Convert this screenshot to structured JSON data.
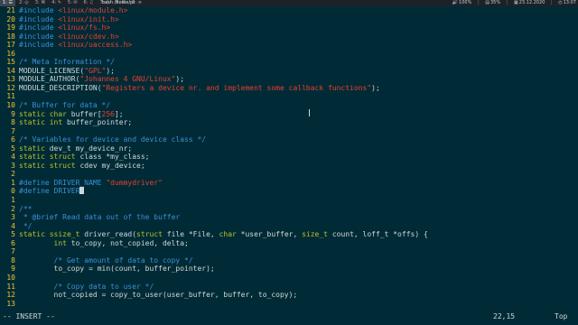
{
  "topbar": {
    "workspaces": [
      "1: ☰",
      "2: ◎",
      "3: ⌘",
      "4: ✎",
      "5: ✉",
      "6: ♫",
      "7: ⬡",
      "8: ☷",
      "9: ≡"
    ],
    "active_workspace": 0,
    "window_title": "bash /home/pi",
    "volume": "100%",
    "cpu": "35%",
    "date": "23.12.2020",
    "time": "13:07"
  },
  "editor": {
    "lines": [
      {
        "n": "21",
        "toks": [
          [
            "pre",
            "#include "
          ],
          [
            "str",
            "<linux/module.h>"
          ]
        ]
      },
      {
        "n": "20",
        "toks": [
          [
            "pre",
            "#include "
          ],
          [
            "str",
            "<linux/init.h>"
          ]
        ]
      },
      {
        "n": "19",
        "toks": [
          [
            "pre",
            "#include "
          ],
          [
            "str",
            "<linux/fs.h>"
          ]
        ]
      },
      {
        "n": "18",
        "toks": [
          [
            "pre",
            "#include "
          ],
          [
            "str",
            "<linux/cdev.h>"
          ]
        ]
      },
      {
        "n": "17",
        "toks": [
          [
            "pre",
            "#include "
          ],
          [
            "str",
            "<linux/uaccess.h>"
          ]
        ]
      },
      {
        "n": "16",
        "toks": []
      },
      {
        "n": "15",
        "toks": [
          [
            "com",
            "/* Meta Information */"
          ]
        ]
      },
      {
        "n": "14",
        "toks": [
          [
            "plain",
            "MODULE_LICENSE("
          ],
          [
            "str",
            "\"GPL\""
          ],
          [
            "plain",
            ");"
          ]
        ]
      },
      {
        "n": "13",
        "toks": [
          [
            "plain",
            "MODULE_AUTHOR("
          ],
          [
            "str",
            "\"Johannes 4 GNU/Linux\""
          ],
          [
            "plain",
            ");"
          ]
        ]
      },
      {
        "n": "12",
        "toks": [
          [
            "plain",
            "MODULE_DESCRIPTION("
          ],
          [
            "str",
            "\"Registers a device nr. and implement some callback functions\""
          ],
          [
            "plain",
            ");"
          ]
        ]
      },
      {
        "n": "11",
        "toks": []
      },
      {
        "n": "10",
        "toks": [
          [
            "com",
            "/* Buffer for data */"
          ]
        ]
      },
      {
        "n": "9",
        "toks": [
          [
            "kw",
            "static char "
          ],
          [
            "plain",
            "buffer["
          ],
          [
            "num",
            "256"
          ],
          [
            "plain",
            "];"
          ]
        ]
      },
      {
        "n": "8",
        "toks": [
          [
            "kw",
            "static int "
          ],
          [
            "plain",
            "buffer_pointer;"
          ]
        ]
      },
      {
        "n": "7",
        "toks": []
      },
      {
        "n": "6",
        "toks": [
          [
            "com",
            "/* Variables for device and device class */"
          ]
        ]
      },
      {
        "n": "5",
        "toks": [
          [
            "kw",
            "static "
          ],
          [
            "plain",
            "dev_t my_device_nr;"
          ]
        ]
      },
      {
        "n": "4",
        "toks": [
          [
            "kw",
            "static struct "
          ],
          [
            "plain",
            "class *my_class;"
          ]
        ]
      },
      {
        "n": "3",
        "toks": [
          [
            "kw",
            "static struct "
          ],
          [
            "plain",
            "cdev my_device;"
          ]
        ]
      },
      {
        "n": "2",
        "toks": []
      },
      {
        "n": "1",
        "toks": [
          [
            "pre",
            "#define DRIVER_NAME "
          ],
          [
            "str",
            "\"dummydriver\""
          ]
        ]
      },
      {
        "n": "0",
        "cursor": true,
        "toks": [
          [
            "pre",
            "#define DRIVER"
          ]
        ]
      },
      {
        "n": "1",
        "toks": []
      },
      {
        "n": "2",
        "toks": [
          [
            "com",
            "/**"
          ]
        ]
      },
      {
        "n": "3",
        "toks": [
          [
            "com",
            " * @brief Read data out of the buffer"
          ]
        ]
      },
      {
        "n": "4",
        "toks": [
          [
            "com",
            " */"
          ]
        ]
      },
      {
        "n": "5",
        "toks": [
          [
            "kw",
            "static ssize_t "
          ],
          [
            "plain",
            "driver_read("
          ],
          [
            "kw",
            "struct "
          ],
          [
            "plain",
            "file *File, "
          ],
          [
            "kw",
            "char "
          ],
          [
            "plain",
            "*user_buffer, "
          ],
          [
            "kw",
            "size_t "
          ],
          [
            "plain",
            "count, loff_t *offs) {"
          ]
        ]
      },
      {
        "n": "6",
        "toks": [
          [
            "plain",
            "        "
          ],
          [
            "kw",
            "int "
          ],
          [
            "plain",
            "to_copy, not_copied, delta;"
          ]
        ]
      },
      {
        "n": "7",
        "toks": []
      },
      {
        "n": "8",
        "toks": [
          [
            "plain",
            "        "
          ],
          [
            "com",
            "/* Get amount of data to copy */"
          ]
        ]
      },
      {
        "n": "9",
        "toks": [
          [
            "plain",
            "        to_copy = min(count, buffer_pointer);"
          ]
        ]
      },
      {
        "n": "10",
        "toks": []
      },
      {
        "n": "11",
        "toks": [
          [
            "plain",
            "        "
          ],
          [
            "com",
            "/* Copy data to user */"
          ]
        ]
      },
      {
        "n": "12",
        "toks": [
          [
            "plain",
            "        not_copied = copy_to_user(user_buffer, buffer, to_copy);"
          ]
        ]
      },
      {
        "n": "13",
        "toks": []
      }
    ]
  },
  "status": {
    "mode": "-- INSERT --",
    "position": "22,15",
    "scroll": "Top"
  }
}
